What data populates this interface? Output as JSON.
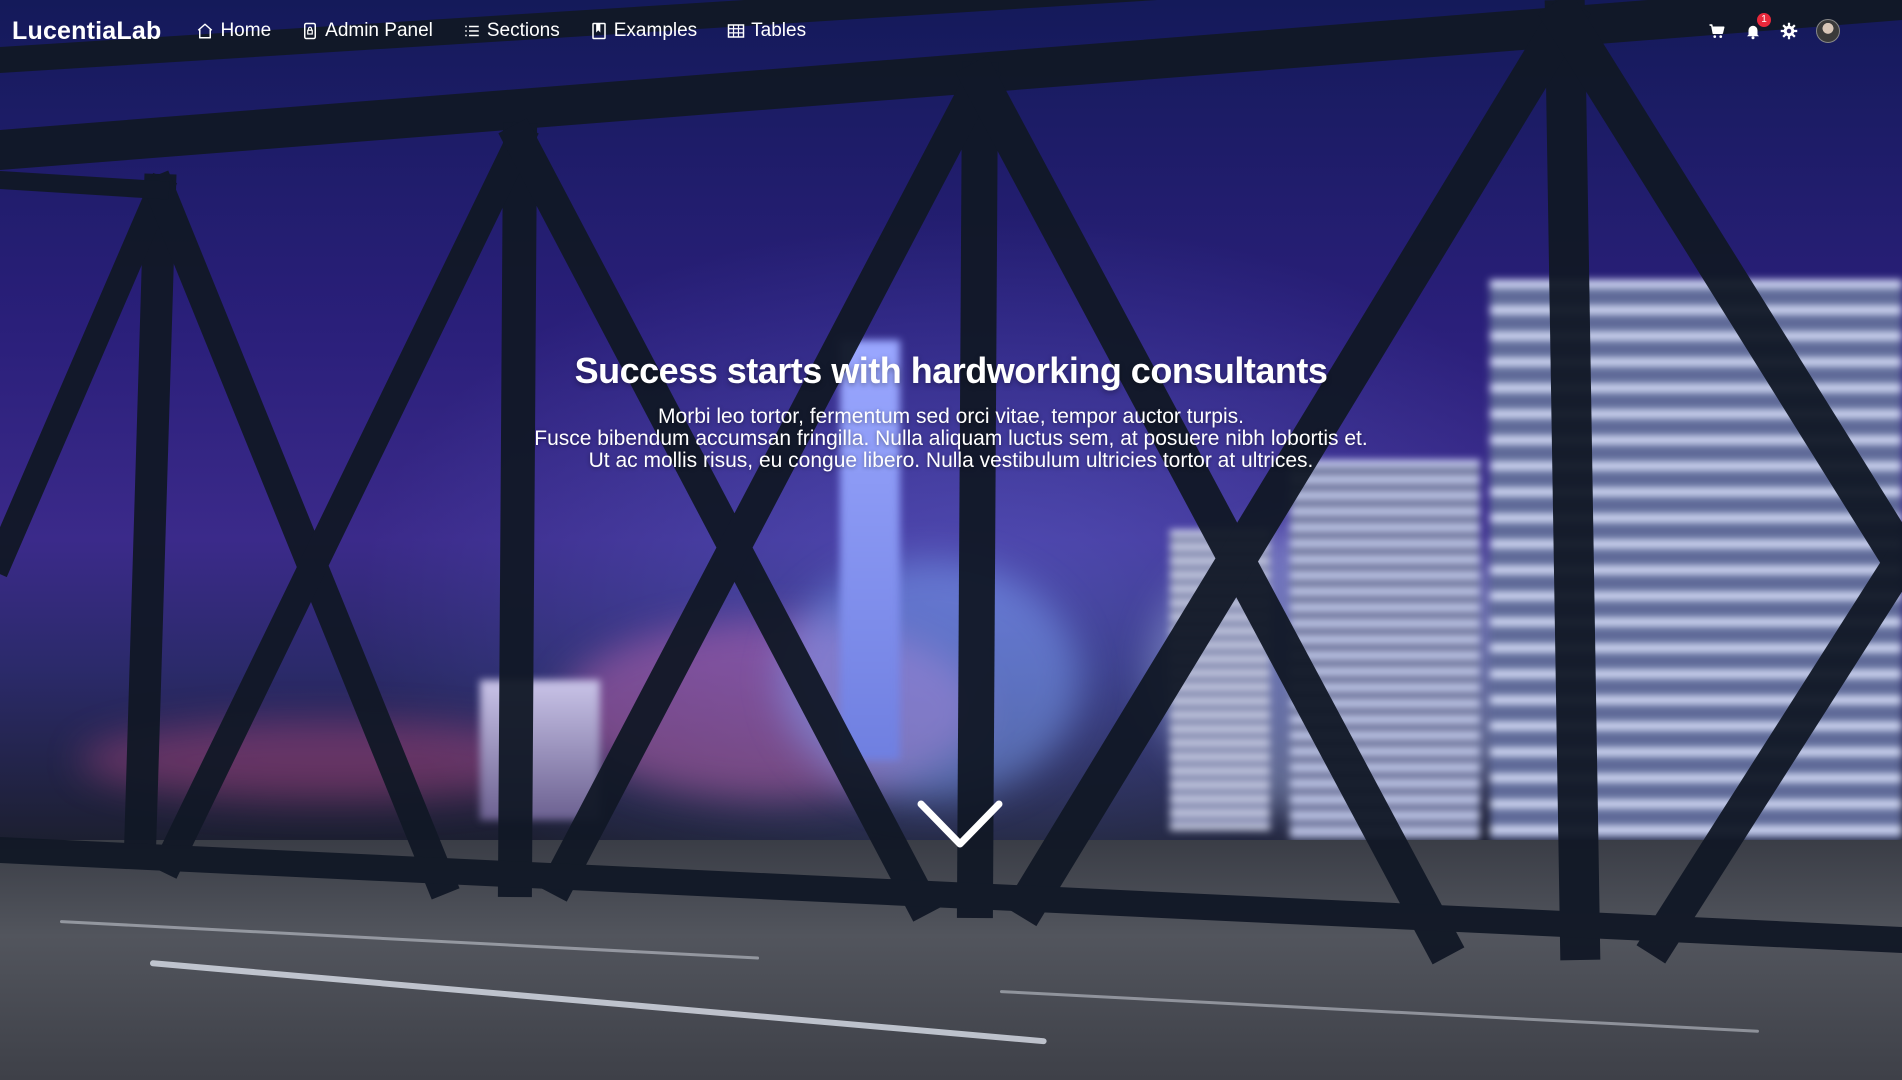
{
  "brand": {
    "name": "LucentiaLab"
  },
  "nav": {
    "items": [
      {
        "label": "Home",
        "icon": "home-icon"
      },
      {
        "label": "Admin Panel",
        "icon": "lock-icon"
      },
      {
        "label": "Sections",
        "icon": "list-icon"
      },
      {
        "label": "Examples",
        "icon": "book-icon"
      },
      {
        "label": "Tables",
        "icon": "table-icon"
      }
    ],
    "right": {
      "cart_icon": "cart-icon",
      "notifications_icon": "bell-icon",
      "notifications_count": "1",
      "settings_icon": "gear-icon",
      "avatar": "avatar"
    }
  },
  "hero": {
    "title": "Success starts with hardworking consultants",
    "lines": [
      "Morbi leo tortor, fermentum sed orci vitae, tempor auctor turpis.",
      "Fusce bibendum accumsan fringilla. Nulla aliquam luctus sem, at posuere nibh lobortis et.",
      "Ut ac mollis risus, eu congue libero. Nulla vestibulum ultricies tortor at ultrices."
    ],
    "scroll_icon": "chevron-down-icon"
  },
  "colors": {
    "badge": "#e8283b",
    "text": "#ffffff"
  }
}
